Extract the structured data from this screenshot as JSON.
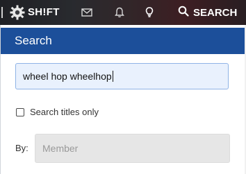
{
  "topbar": {
    "logo_text": "SH!FT",
    "search_label": "SEARCH",
    "icons": [
      "gear-logo-icon",
      "mail-icon",
      "bell-icon",
      "lightbulb-icon",
      "search-icon"
    ]
  },
  "search_panel": {
    "title": "Search",
    "keywords_value": "wheel hop wheelhop",
    "titles_only_label": "Search titles only",
    "titles_only_checked": false,
    "by_label": "By:",
    "member_placeholder": "Member"
  },
  "colors": {
    "header_blue": "#1c4f9a",
    "input_focus_border": "#8fb3e6",
    "input_focus_bg": "#e9f1fd"
  }
}
